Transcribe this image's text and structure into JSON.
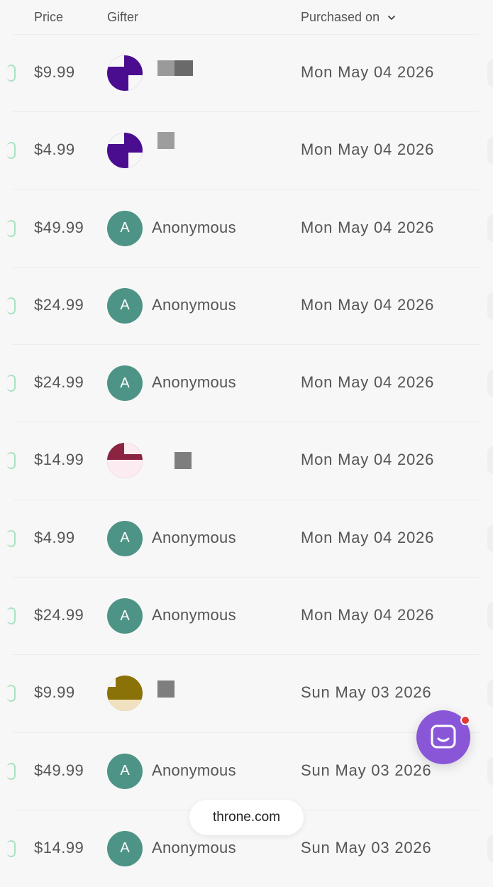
{
  "columns": {
    "price": "Price",
    "gifter": "Gifter",
    "purchased_on": "Purchased on"
  },
  "rows": [
    {
      "price": "$9.99",
      "gifter": "",
      "avatar": "redacted-purple",
      "date": "Mon May 04 2026"
    },
    {
      "price": "$4.99",
      "gifter": "",
      "avatar": "redacted-purple",
      "date": "Mon May 04 2026"
    },
    {
      "price": "$49.99",
      "gifter": "Anonymous",
      "initial": "A",
      "avatar": "anon",
      "date": "Mon May 04 2026"
    },
    {
      "price": "$24.99",
      "gifter": "Anonymous",
      "initial": "A",
      "avatar": "anon",
      "date": "Mon May 04 2026"
    },
    {
      "price": "$24.99",
      "gifter": "Anonymous",
      "initial": "A",
      "avatar": "anon",
      "date": "Mon May 04 2026"
    },
    {
      "price": "$14.99",
      "gifter": "",
      "avatar": "redacted-maroon",
      "date": "Mon May 04 2026"
    },
    {
      "price": "$4.99",
      "gifter": "Anonymous",
      "initial": "A",
      "avatar": "anon",
      "date": "Mon May 04 2026"
    },
    {
      "price": "$24.99",
      "gifter": "Anonymous",
      "initial": "A",
      "avatar": "anon",
      "date": "Mon May 04 2026"
    },
    {
      "price": "$9.99",
      "gifter": "",
      "avatar": "redacted-olive",
      "date": "Sun May 03 2026"
    },
    {
      "price": "$49.99",
      "gifter": "Anonymous",
      "initial": "A",
      "avatar": "anon",
      "date": "Sun May 03 2026"
    },
    {
      "price": "$14.99",
      "gifter": "Anonymous",
      "initial": "A",
      "avatar": "anon",
      "date": "Sun May 03 2026"
    }
  ],
  "footer": {
    "domain": "throne.com"
  },
  "colors": {
    "anon_avatar": "#4e9486",
    "help_button": "#8a56d8",
    "notification_dot": "#e53935",
    "status_green": "#a7e3c1"
  },
  "icons": {
    "sort": "chevron-down-icon",
    "help": "chat-bubble-icon"
  }
}
